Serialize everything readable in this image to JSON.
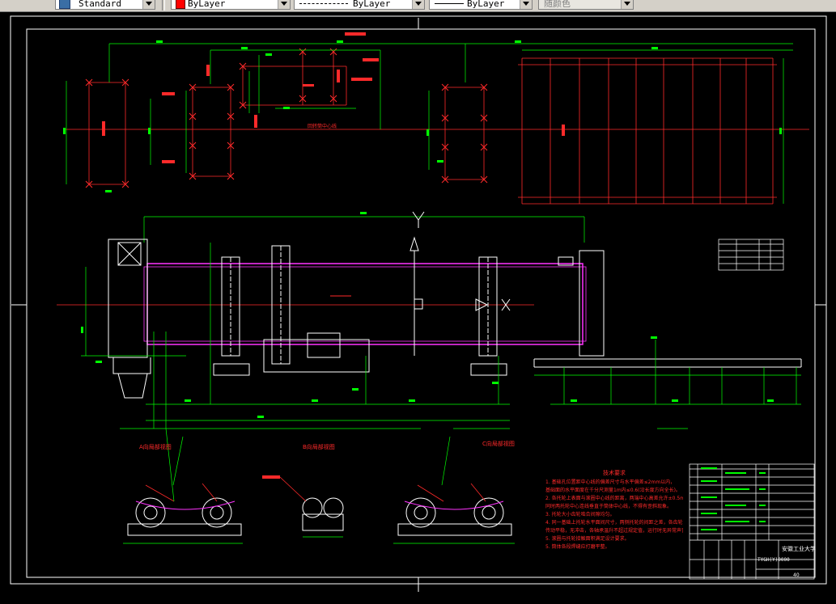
{
  "toolbar": {
    "text_style": "Standard",
    "layer_color": "ByLayer",
    "linetype": "ByLayer",
    "lineweight": "ByLayer",
    "plot_style": "随颜色"
  },
  "colors": {
    "background": "#000000",
    "red": "#ff2a2a",
    "green": "#00ff00",
    "magenta": "#ff33ff",
    "white": "#ffffff"
  },
  "drawing": {
    "section_label_1": "回转筒中心线",
    "view_a_label": "A向局部视图",
    "view_b_label": "B向局部视图",
    "view_c_label": "C向局部视图",
    "tech_req_title": "技术要求",
    "tech_req_items": [
      "1. 基础孔位置距中心线的偏差尺寸与水平偏差≤2mm以内，",
      "基础面的水平面度在千分尺测量1m内≤0.6(沿长度方向全长)。",
      "2. 各托轮上表面与滚圈中心线的距离，两端中心高差允许±0.5mm。",
      "同时两托轮中心连线垂直于筒体中心线，不得有歪斜现象。",
      "3. 托轮大小齿轮啮合间隙均匀。",
      "4. 同一基础上托轮水平面间尺寸，两侧托轮的间距之差，各齿轮啮合",
      "传动平稳，无冲击，各轴承温升不超过规定值，运行时无异常声音。",
      "5. 滚圈与托轮接触面积满足设计要求。",
      "5. 筒体各段焊缝应打磨平整。"
    ],
    "title_block": {
      "school": "安徽工业大学",
      "drawing_no": "TYGH(Y)0000",
      "sheet": "40"
    }
  }
}
